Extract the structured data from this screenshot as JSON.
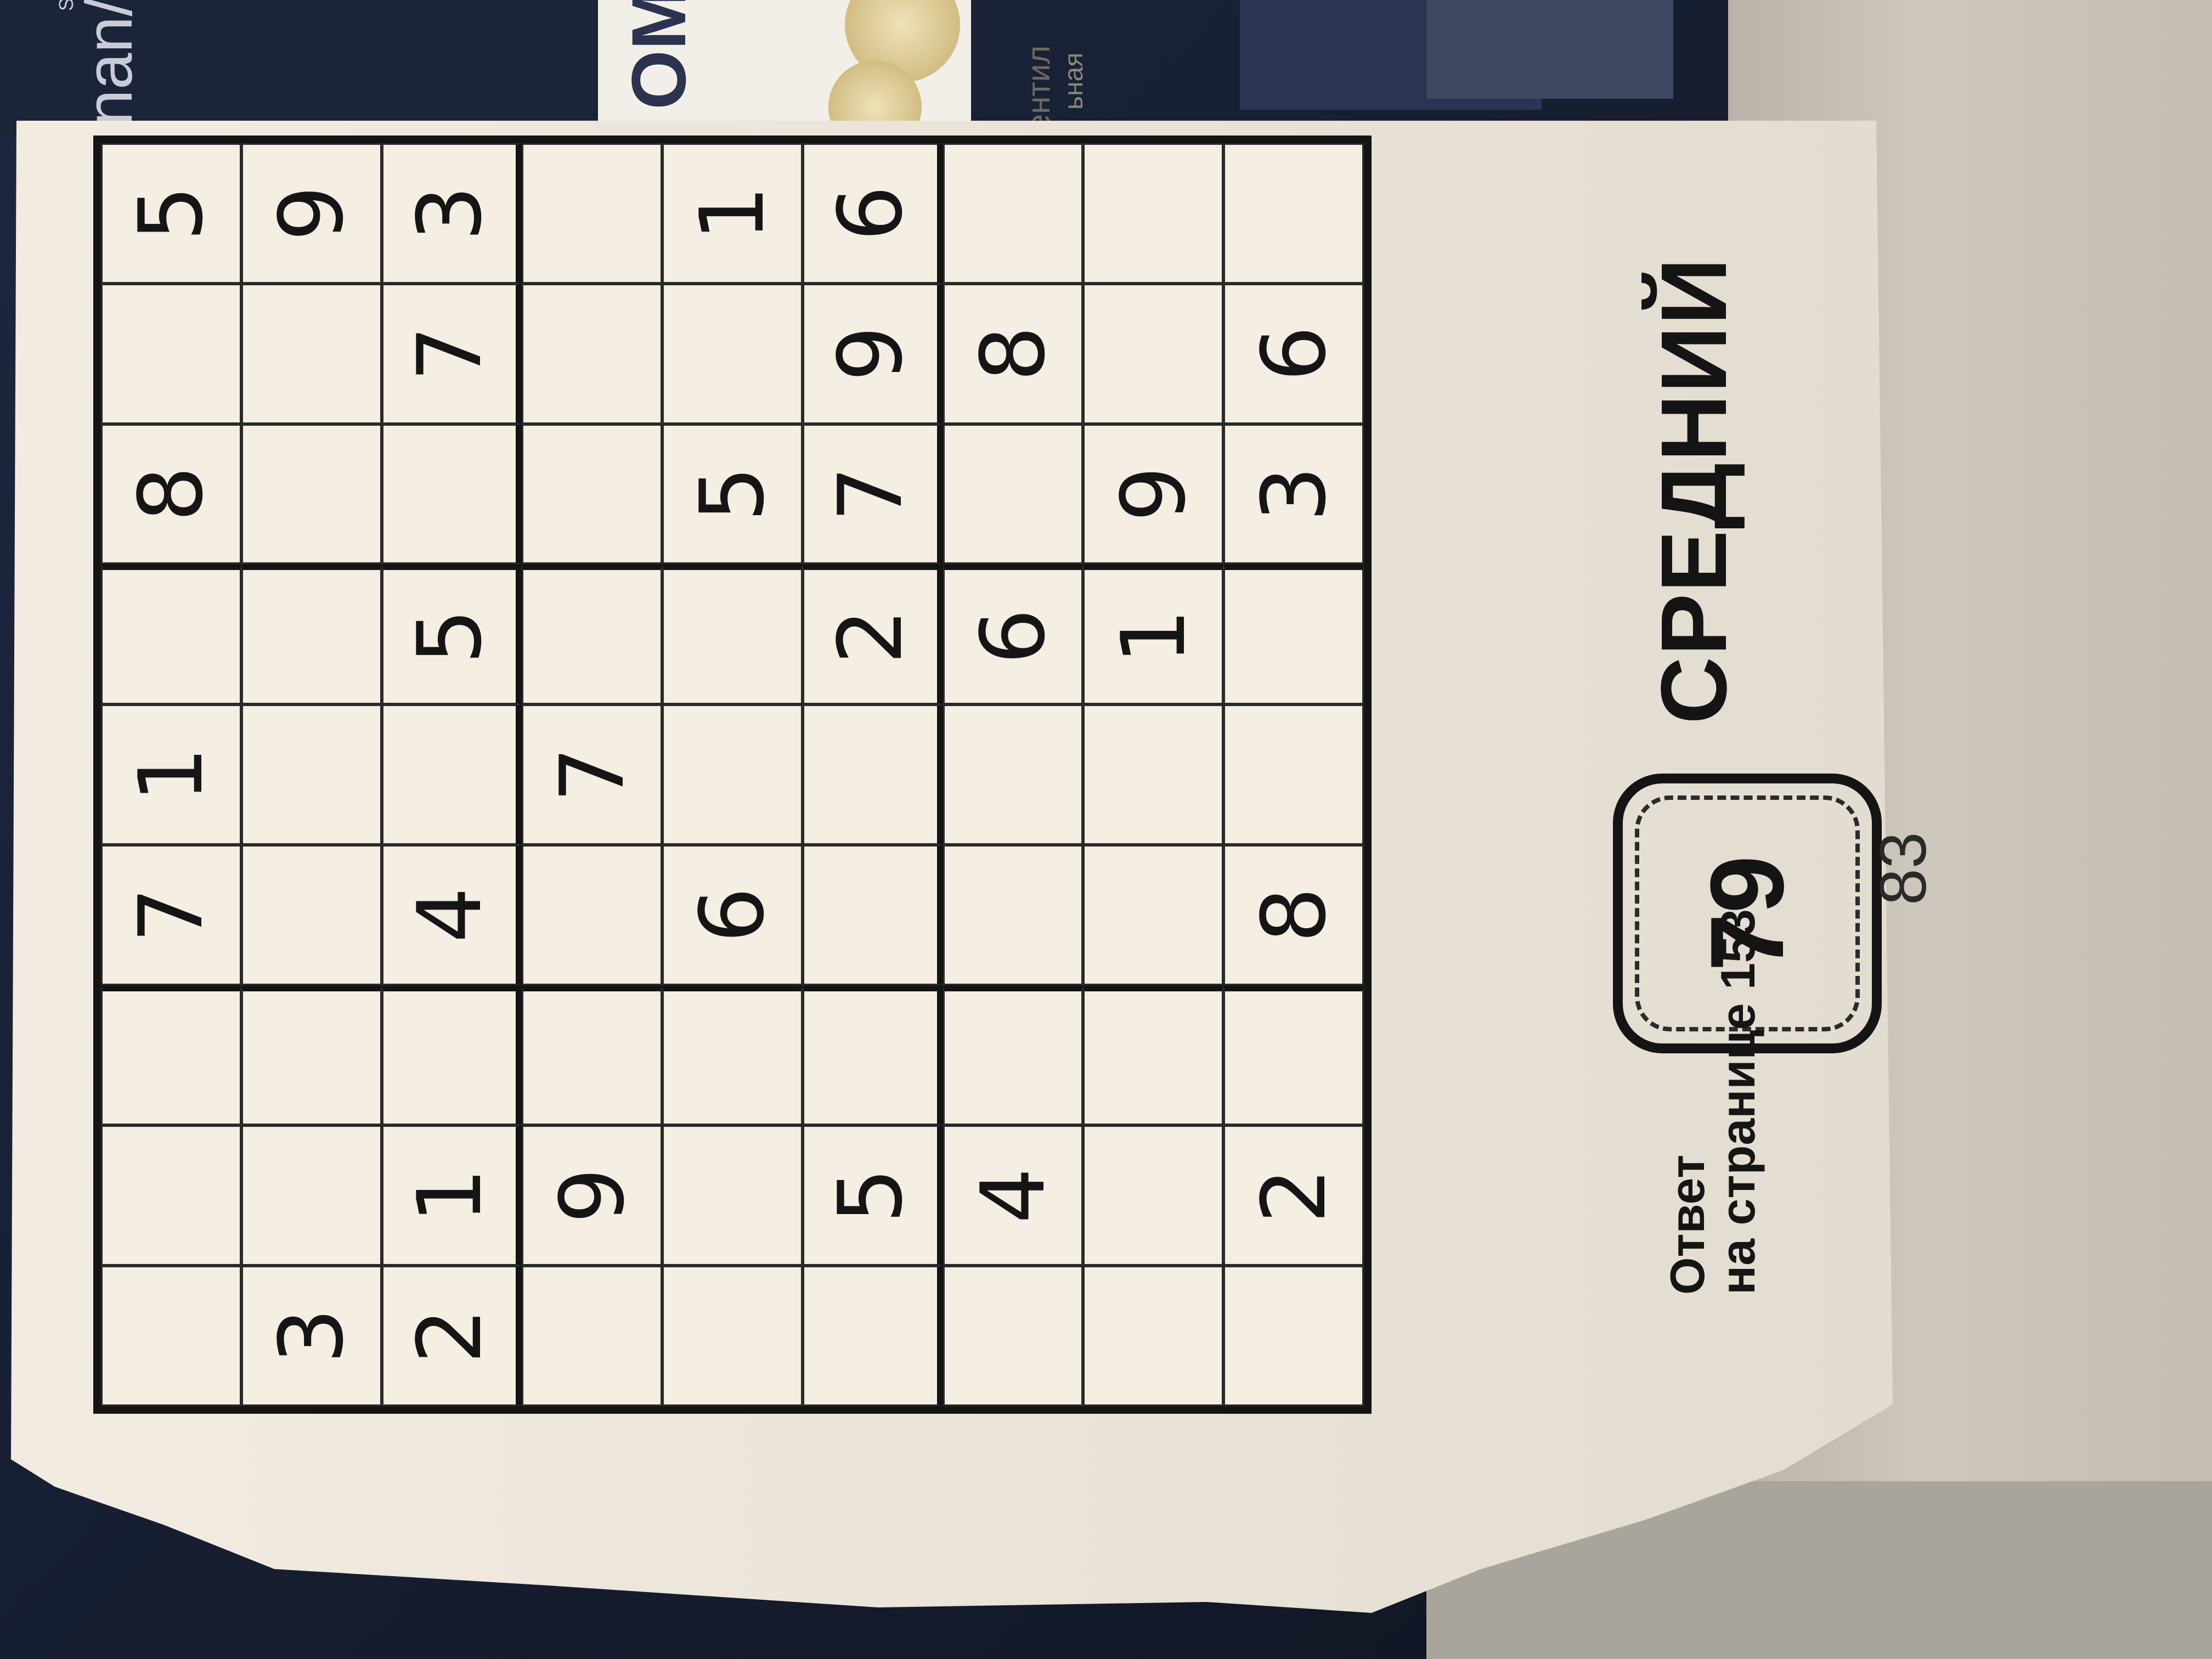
{
  "background": {
    "card_dark_text_small": "SOUND",
    "card_dark_text_large": "nan/k",
    "card_white_line1": "ентил",
    "card_white_line2": "ьная",
    "card_logo": "OMI"
  },
  "page": {
    "level_label": "СРЕДНИЙ",
    "puzzle_number": "79",
    "answer_line1": "Ответ",
    "answer_line2": "на странице 153",
    "page_number": "83"
  },
  "sudoku": {
    "rows": [
      [
        "",
        "",
        "",
        "7",
        "1",
        "",
        "8",
        "",
        "5"
      ],
      [
        "3",
        "",
        "",
        "",
        "",
        "",
        "",
        "",
        "9"
      ],
      [
        "2",
        "1",
        "",
        "4",
        "",
        "5",
        "",
        "7",
        "3"
      ],
      [
        "",
        "9",
        "",
        "",
        "7",
        "",
        "",
        "",
        ""
      ],
      [
        "",
        "",
        "",
        "6",
        "",
        "",
        "5",
        "",
        "1"
      ],
      [
        "",
        "5",
        "",
        "",
        "",
        "2",
        "7",
        "9",
        "6"
      ],
      [
        "",
        "4",
        "",
        "",
        "",
        "6",
        "",
        "8",
        ""
      ],
      [
        "",
        "",
        "",
        "",
        "",
        "1",
        "9",
        "",
        ""
      ],
      [
        "",
        "2",
        "",
        "8",
        "",
        "",
        "3",
        "6",
        ""
      ]
    ]
  }
}
